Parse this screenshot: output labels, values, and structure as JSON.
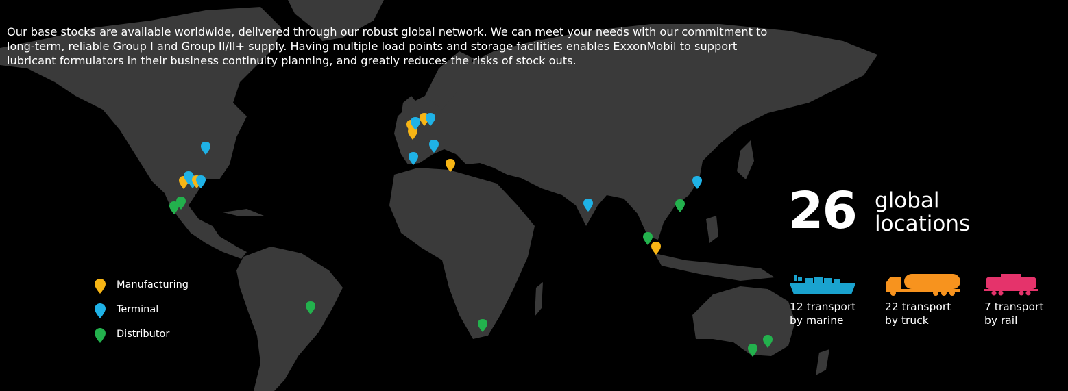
{
  "intro_text": "Our base stocks are available worldwide, delivered through our robust global network. We can meet your needs with our commitment to long-term, reliable Group I and Group II/II+ supply. Having multiple load points and storage facilities enables ExxonMobil to support lubricant formulators in their business continuity planning, and greatly reduces the risks of stock outs.",
  "headline": {
    "value": "26",
    "unit": "global locations"
  },
  "colors": {
    "manufacturing": "#f7b515",
    "terminal": "#1fb2e6",
    "distributor": "#23b14d",
    "marine": "#1aa3cf",
    "truck": "#f7931e",
    "rail": "#e5336b"
  },
  "legend": [
    {
      "type": "manufacturing",
      "label": "Manufacturing",
      "icon": "pin-yellow-icon"
    },
    {
      "type": "terminal",
      "label": "Terminal",
      "icon": "pin-blue-icon"
    },
    {
      "type": "distributor",
      "label": "Distributor",
      "icon": "pin-green-icon"
    }
  ],
  "transport": [
    {
      "mode": "marine",
      "number_text": "12 transport",
      "mode_text": "by marine",
      "icon": "ship-icon"
    },
    {
      "mode": "truck",
      "number_text": "22 transport",
      "mode_text": "by truck",
      "icon": "tanker-truck-icon"
    },
    {
      "mode": "rail",
      "number_text": "7 transport",
      "mode_text": "by rail",
      "icon": "rail-tanker-icon"
    }
  ]
}
